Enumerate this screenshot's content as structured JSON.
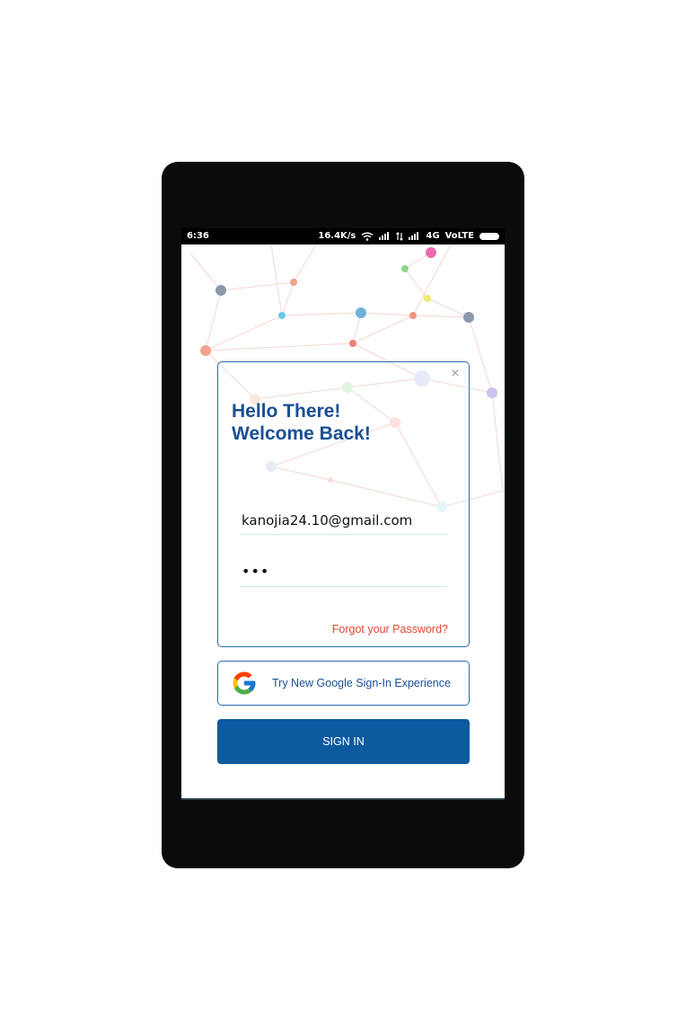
{
  "status_bar": {
    "time": "6:36",
    "net_speed": "16.4K/s",
    "network": "4G",
    "volte": "VoLTE",
    "icons": [
      "wifi-icon",
      "data-arrows-icon",
      "signal-icon",
      "battery-icon"
    ]
  },
  "login": {
    "heading_line1": "Hello There!",
    "heading_line2": "Welcome Back!",
    "email_value": "kanojia24.10@gmail.com",
    "password_value": "•••",
    "forgot_label": "Forgot your Password?",
    "close_icon": "close-icon"
  },
  "google_signin": {
    "label": "Try New Google Sign-In Experience",
    "icon": "google-logo-icon"
  },
  "signin_button": {
    "label": "SIGN IN"
  },
  "colors": {
    "heading": "#1a4f92",
    "accent_border": "#2e6aa8",
    "primary_button": "#0d5aa0",
    "forgot_link": "#e2472e",
    "field_underline": "#c9ece6"
  }
}
